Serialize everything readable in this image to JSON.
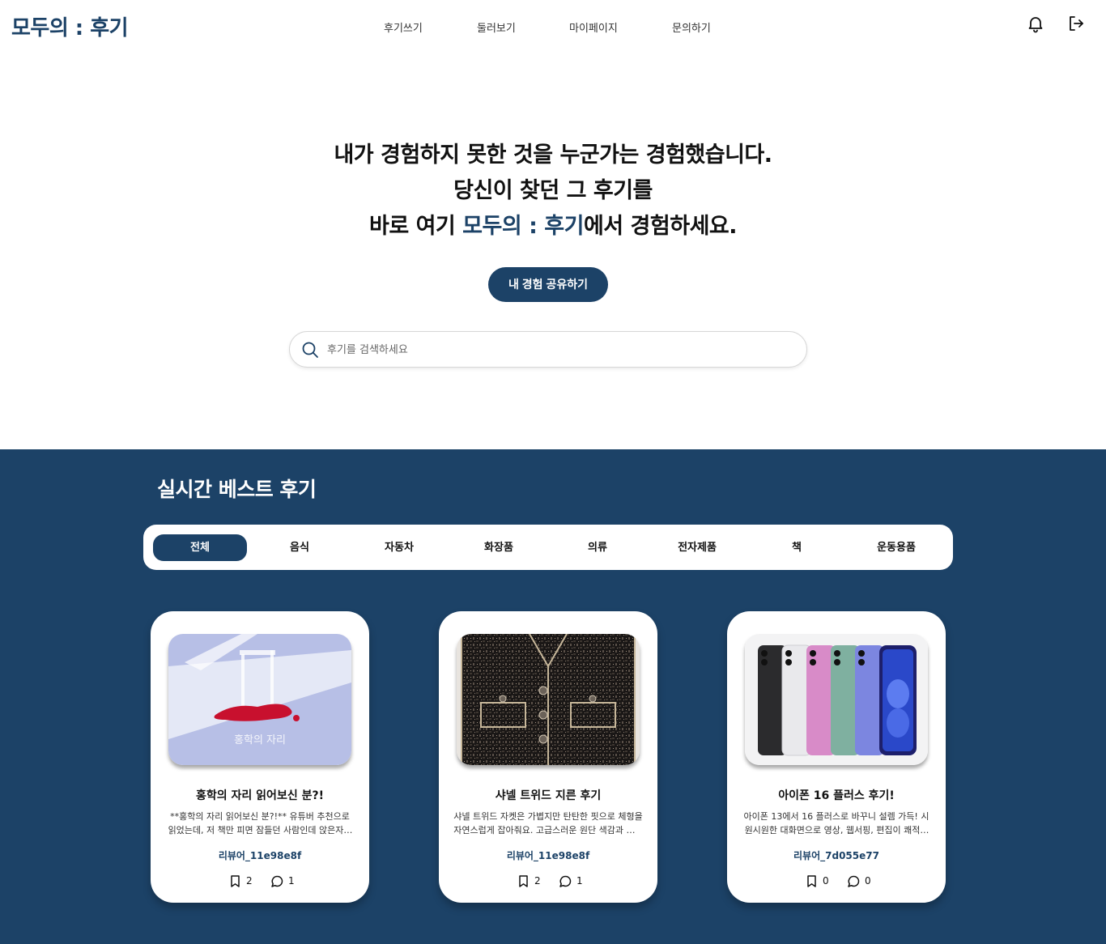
{
  "header": {
    "logo": "모두의 : 후기",
    "nav": [
      "후기쓰기",
      "둘러보기",
      "마이페이지",
      "문의하기"
    ],
    "icons": [
      "bell-icon",
      "logout-icon"
    ]
  },
  "hero": {
    "line1": "내가 경험하지 못한 것을 누군가는 경험했습니다.",
    "line2": "당신이 찾던 그 후기를",
    "line3_prefix": "바로 여기 ",
    "line3_accent": "모두의 : 후기",
    "line3_suffix": "에서 경험하세요.",
    "cta_label": "내 경험 공유하기"
  },
  "search": {
    "placeholder": "후기를 검색하세요",
    "value": ""
  },
  "best": {
    "title": "실시간 베스트 후기",
    "tabs": [
      "전체",
      "음식",
      "자동차",
      "화장품",
      "의류",
      "전자제품",
      "책",
      "운동용품"
    ],
    "active_tab": "전체",
    "cards": [
      {
        "image_caption": "홍학의 자리",
        "title": "홍학의 자리 읽어보신 분?!",
        "description": "**홍학의 자리 읽어보신 분?!** 유튜버 추천으로 읽었는데, 저 책만 피면 잠들던 사람인데 앉은자리에서 다 읽었어요",
        "author": "리뷰어_11e98e8f",
        "bookmarks": "2",
        "comments": "1"
      },
      {
        "title": "샤넬 트위드 지른 후기",
        "description": "샤넬 트위드 자켓은 가볍지만 탄탄한 핏으로 체형을 자연스럽게 잡아줘요. 고급스러운 원단 색감과 입체적인 짜임이",
        "author": "리뷰어_11e98e8f",
        "bookmarks": "2",
        "comments": "1"
      },
      {
        "title": "아이폰 16 플러스 후기!",
        "description": "아이폰 13에서 16 플러스로 바꾸니 설렘 가득! 시원시원한 대화면으로 영상, 웹서핑, 편집이 쾌적하고, 배터리도",
        "author": "리뷰어_7d055e77",
        "bookmarks": "0",
        "comments": "0"
      }
    ]
  },
  "colors": {
    "brand": "#1c4267",
    "background": "#ffffff",
    "card": "#ffffff"
  }
}
